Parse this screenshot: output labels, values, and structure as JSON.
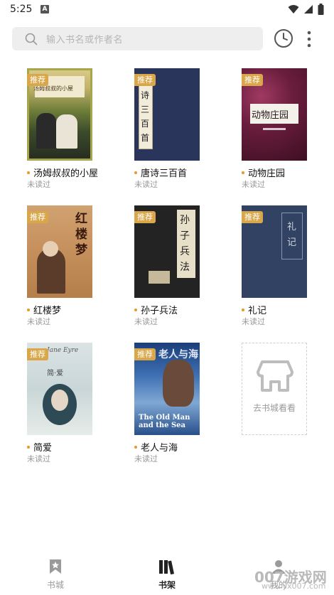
{
  "status_bar": {
    "time": "5:25",
    "notification_letter": "A"
  },
  "search": {
    "placeholder": "输入书名或作者名"
  },
  "books": [
    {
      "title": "汤姆叔叔的小屋",
      "status": "未读过",
      "badge": "推荐"
    },
    {
      "title": "唐诗三百首",
      "status": "未读过",
      "badge": "推荐"
    },
    {
      "title": "动物庄园",
      "status": "未读过",
      "badge": "推荐"
    },
    {
      "title": "红楼梦",
      "status": "未读过",
      "badge": "推荐"
    },
    {
      "title": "孙子兵法",
      "status": "未读过",
      "badge": "推荐"
    },
    {
      "title": "礼记",
      "status": "未读过",
      "badge": "推荐"
    },
    {
      "title": "简爱",
      "status": "未读过",
      "badge": "推荐"
    },
    {
      "title": "老人与海",
      "status": "未读过",
      "badge": "推荐"
    }
  ],
  "covers": {
    "tom": "汤姆叔叔的小屋",
    "tang": "诗三百首",
    "animal": "动物庄园",
    "red": "红楼梦",
    "sunzi": "孙子兵法",
    "liji": "礼记",
    "jane_en": "Jane Eyre",
    "jane_cn": "简·爱",
    "oldman_cn": "老人与海",
    "oldman_en": "The Old Man and the Sea"
  },
  "add_card": {
    "label": "去书城看看"
  },
  "bottom_nav": {
    "store": "书城",
    "shelf": "书架",
    "mine": "我的"
  },
  "watermark": {
    "main": "007游戏网",
    "sub": "www.yx007.com"
  },
  "colors": {
    "badge": "#d9a74a",
    "dot": "#e49a2a",
    "active_nav": "#222222",
    "inactive_nav": "#9a9a9a"
  }
}
